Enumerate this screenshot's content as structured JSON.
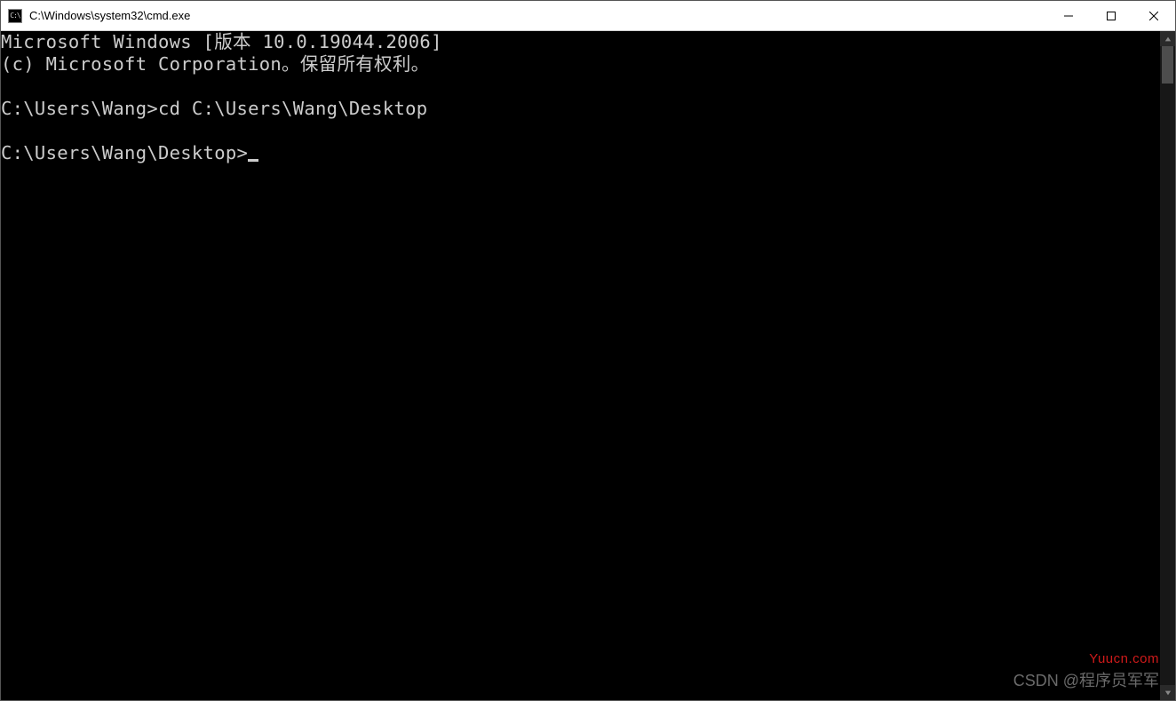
{
  "titlebar": {
    "icon_label": "C:\\",
    "title": "C:\\Windows\\system32\\cmd.exe",
    "buttons": {
      "minimize": "minimize-icon",
      "maximize": "maximize-icon",
      "close": "close-icon"
    }
  },
  "terminal": {
    "line1": "Microsoft Windows [版本 10.0.19044.2006]",
    "line2": "(c) Microsoft Corporation。保留所有权利。",
    "blank1": "",
    "prompt1": "C:\\Users\\Wang>",
    "command1": "cd C:\\Users\\Wang\\Desktop",
    "blank2": "",
    "prompt2": "C:\\Users\\Wang\\Desktop>"
  },
  "watermarks": {
    "site": "Yuucn.com",
    "csdn": "CSDN @程序员军军"
  }
}
